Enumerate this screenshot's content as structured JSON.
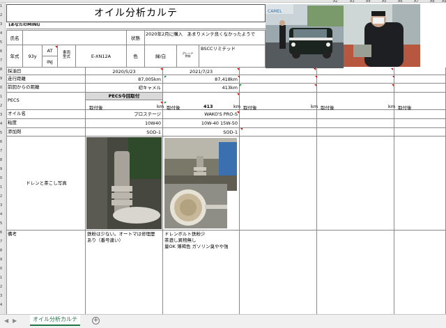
{
  "sheet": {
    "title": "オイル分析カルテ",
    "section_label": "【あなたのMINI】",
    "col_headers": [
      "A2",
      "A3",
      "A4",
      "A5",
      "A6",
      "A7",
      "A8",
      "A9"
    ],
    "row_numbers": [
      "1",
      "2",
      "3",
      "4",
      "5",
      "6",
      "7",
      "8",
      "9",
      "0",
      "1",
      "2",
      "3",
      "4",
      "5",
      "6",
      "7",
      "8",
      "9",
      "0",
      "1",
      "2",
      "3",
      "4",
      "5",
      "6",
      "7",
      "8",
      "9",
      "0",
      "1",
      "2",
      "3",
      "4"
    ]
  },
  "owner": {
    "name_label": "氏名",
    "name_value": "",
    "status_label": "状態",
    "status_value": "2020年2月に購入　あまりメンテ良くなかったようで"
  },
  "vehicle": {
    "year_label": "年式",
    "year_value": "93y",
    "trans_at": "AT",
    "trans_inj": "INJ",
    "model_label": "車両\n型式",
    "model_value": "E-XN12A",
    "color_label": "色",
    "color_value": "緑/白",
    "grade_label": "グレード\n特装",
    "grade_value": "BSCCリミテッド"
  },
  "rows": {
    "sample_date": "採油日",
    "mileage": "走行距離",
    "since_last": "前回からの距離",
    "pecs": "PECS",
    "oil_name": "オイル名",
    "viscosity": "粘度",
    "additive": "添加剤",
    "photo_label": "ドレンと茶こし写真",
    "remarks": "備考"
  },
  "col1": {
    "date": "2020/5/23",
    "mileage": "87,005km",
    "since_last": "初キャメル",
    "pecs_header": "PECS今回取付",
    "pecs_label": "取付後",
    "pecs_unit": "km",
    "oil_name": "プロステージ",
    "viscosity": "10W40",
    "additive": "SOD-1",
    "remarks": "鉄粉は少ない。オートマは修理歴\nあり（番号違い）"
  },
  "col2": {
    "date": "2021/7/23",
    "mileage": "87,418km",
    "since_last": "413km",
    "pecs_label": "取付後",
    "pecs_value": "413",
    "pecs_unit": "km",
    "oil_name": "WAKO'S PRO-S",
    "viscosity": "10W-40 15W-50",
    "additive": "SOD-1",
    "remarks": "ドレンボルト鉄粉少\n茶漉し異物無し\n量OK 薄褐色 ガソリン臭やや強"
  },
  "col3": {
    "pecs_label": "取付後",
    "pecs_unit": "km"
  },
  "col4": {
    "pecs_label": "取付後",
    "pecs_unit": "km"
  },
  "col5": {
    "pecs_label": "取付後"
  },
  "tabs": {
    "active": "オイル分析カルテ",
    "add": "+",
    "nav_prev": "◀",
    "nav_next": "▶"
  },
  "colors": {
    "accent": "#217346",
    "gridline": "#888888",
    "header_bg": "#e6e6e6",
    "pecs_bg": "#d9d9d9"
  }
}
